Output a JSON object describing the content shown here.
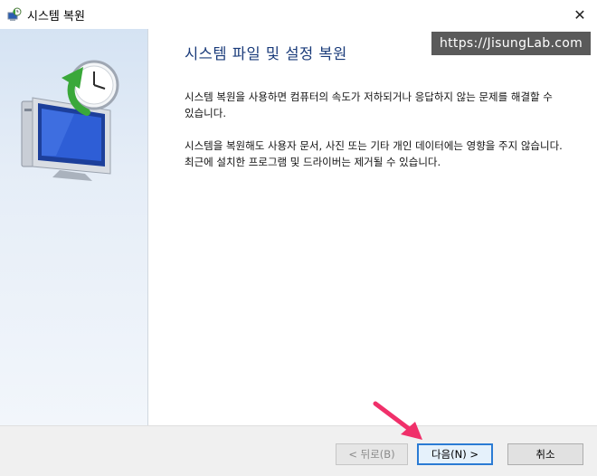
{
  "window": {
    "title": "시스템 복원"
  },
  "content": {
    "heading": "시스템 파일 및 설정 복원",
    "paragraph1": "시스템 복원을 사용하면 컴퓨터의 속도가 저하되거나 응답하지 않는 문제를 해결할 수 있습니다.",
    "paragraph2": "시스템을 복원해도 사용자 문서, 사진 또는 기타 개인 데이터에는 영향을 주지 않습니다. 최근에 설치한 프로그램 및 드라이버는 제거될 수 있습니다."
  },
  "watermark": "https://JisungLab.com",
  "buttons": {
    "back": "< 뒤로(B)",
    "next": "다음(N) >",
    "cancel": "취소",
    "close": "✕"
  },
  "colors": {
    "heading": "#1a3b7a",
    "accent": "#2b7bd4",
    "annotation_arrow": "#f0306a"
  }
}
